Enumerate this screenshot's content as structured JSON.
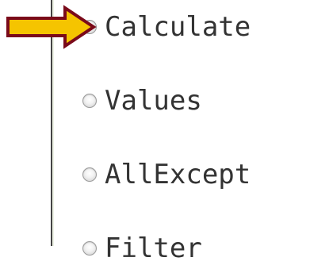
{
  "options": [
    {
      "label": "Calculate"
    },
    {
      "label": "Values"
    },
    {
      "label": "AllExcept"
    },
    {
      "label": "Filter"
    }
  ],
  "annotation": {
    "icon": "arrow-right-icon",
    "fill": "#f5c400",
    "stroke": "#7a0a1a"
  }
}
